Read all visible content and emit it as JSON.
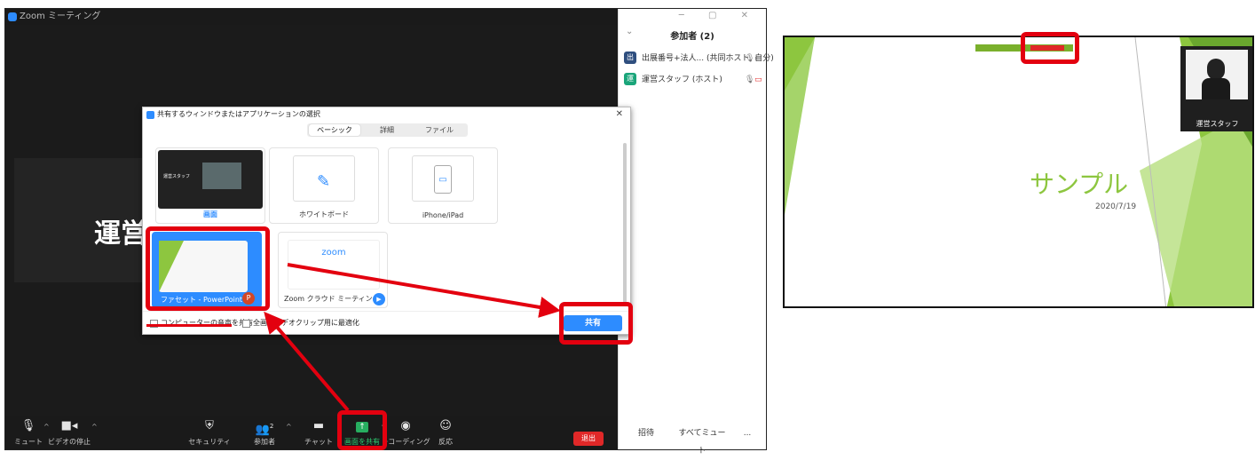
{
  "zoom": {
    "window_title": "Zoom ミーティング",
    "presenter_name": "運営",
    "participants": {
      "header": "参加者 (2)",
      "items": [
        {
          "avatar": "出",
          "name": "出展番号+法人... (共同ホスト, 自分)",
          "color": "#2f4f7f"
        },
        {
          "avatar": "運",
          "name": "運営スタッフ (ホスト)",
          "color": "#1aa57a"
        }
      ],
      "footer": {
        "invite": "招待",
        "mute_all": "すべてミュート",
        "more": "..."
      }
    },
    "toolbar": {
      "mute": "ミュート",
      "video": "ビデオの停止",
      "security": "セキュリティ",
      "participants": "参加者",
      "participants_count": "2",
      "chat": "チャット",
      "share": "画面を共有",
      "record": "レコーディング",
      "reactions": "反応",
      "end": "退出"
    }
  },
  "share_dialog": {
    "title": "共有するウィンドウまたはアプリケーションの選択",
    "tabs": [
      "ベーシック",
      "詳細",
      "ファイル"
    ],
    "active_tab": "ベーシック",
    "tiles": {
      "screen": "画面",
      "whiteboard": "ホワイトボード",
      "iphone": "iPhone/iPad",
      "ppt": "ファセット - PowerPoint",
      "zoom_meeting": "Zoom クラウド ミーティング",
      "zoom_logo": "zoom",
      "screen_thumb_name": "運営スタッフ"
    },
    "options": {
      "share_audio": "コンピューターの音声を共有",
      "optimize": "全画面ビデオクリップ用に最適化"
    },
    "share_button": "共有"
  },
  "slide_preview": {
    "title": "サンプル",
    "date": "2020/7/19",
    "video_name": "運営スタッフ"
  },
  "colors": {
    "zoom_blue": "#2d8cff",
    "annotation_red": "#e3000f",
    "slide_green": "#8dc63f"
  }
}
